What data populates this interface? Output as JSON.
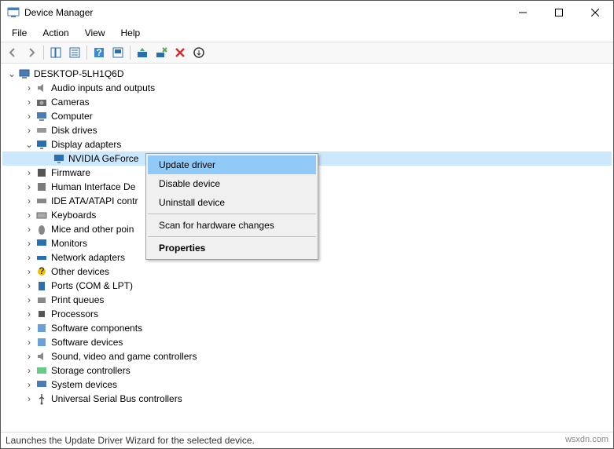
{
  "window_title": "Device Manager",
  "menu": {
    "file": "File",
    "action": "Action",
    "view": "View",
    "help": "Help"
  },
  "root": "DESKTOP-5LH1Q6D",
  "categories": [
    "Audio inputs and outputs",
    "Cameras",
    "Computer",
    "Disk drives",
    "Display adapters",
    "Firmware",
    "Human Interface De",
    "IDE ATA/ATAPI contr",
    "Keyboards",
    "Mice and other poin",
    "Monitors",
    "Network adapters",
    "Other devices",
    "Ports (COM & LPT)",
    "Print queues",
    "Processors",
    "Software components",
    "Software devices",
    "Sound, video and game controllers",
    "Storage controllers",
    "System devices",
    "Universal Serial Bus controllers"
  ],
  "selected_device": "NVIDIA GeForce",
  "context_menu": {
    "update": "Update driver",
    "disable": "Disable device",
    "uninstall": "Uninstall device",
    "scan": "Scan for hardware changes",
    "properties": "Properties"
  },
  "status_text": "Launches the Update Driver Wizard for the selected device.",
  "watermark": "wsxdn.com"
}
